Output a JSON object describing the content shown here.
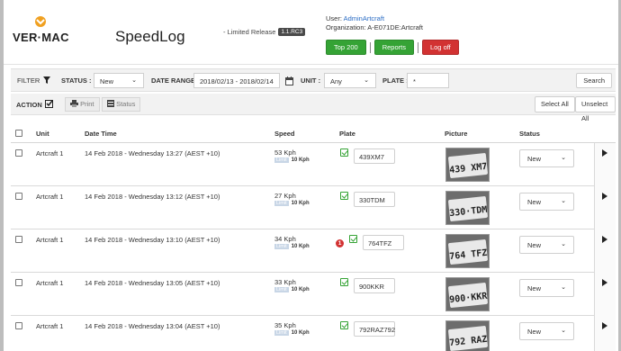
{
  "brand": {
    "logo_text": "VER·MAC",
    "app_title": "SpeedLog",
    "release_text": "- Limited Release",
    "release_badge": "1.1.RC3"
  },
  "user": {
    "user_label": "User:",
    "user_name": "AdminArtcraft",
    "org_line": "Organization: A-E071DE:Artcraft"
  },
  "header_buttons": {
    "top200": "Top 200",
    "reports": "Reports",
    "logoff": "Log off"
  },
  "filter": {
    "label": "FILTER",
    "status_label": "STATUS :",
    "status_value": "New",
    "date_label": "DATE RANGE :",
    "date_value": "2018/02/13 - 2018/02/14",
    "unit_label": "UNIT :",
    "unit_value": "Any",
    "plate_label": "PLATE :",
    "plate_value": "*",
    "search_label": "Search"
  },
  "actions": {
    "label": "ACTION",
    "print": "Print",
    "status": "Status",
    "select_all": "Select All",
    "unselect_all": "Unselect All"
  },
  "columns": {
    "unit": "Unit",
    "datetime": "Date Time",
    "speed": "Speed",
    "plate": "Plate",
    "picture": "Picture",
    "status": "Status"
  },
  "rows": [
    {
      "unit": "Artcraft 1",
      "datetime": "14 Feb 2018 - Wednesday 13:27 (AEST +10)",
      "speed": "53 Kph",
      "limit_tag": "Limit",
      "limit": "10 Kph",
      "plate": "439XM7",
      "picture_text": "439 XM7",
      "status": "New",
      "warning": ""
    },
    {
      "unit": "Artcraft 1",
      "datetime": "14 Feb 2018 - Wednesday 13:12 (AEST +10)",
      "speed": "27 Kph",
      "limit_tag": "Limit",
      "limit": "10 Kph",
      "plate": "330TDM",
      "picture_text": "330·TDM",
      "status": "New",
      "warning": ""
    },
    {
      "unit": "Artcraft 1",
      "datetime": "14 Feb 2018 - Wednesday 13:10 (AEST +10)",
      "speed": "34 Kph",
      "limit_tag": "Limit",
      "limit": "10 Kph",
      "plate": "764TFZ",
      "picture_text": "764 TFZ",
      "status": "New",
      "warning": "1"
    },
    {
      "unit": "Artcraft 1",
      "datetime": "14 Feb 2018 - Wednesday 13:05 (AEST +10)",
      "speed": "33 Kph",
      "limit_tag": "Limit",
      "limit": "10 Kph",
      "plate": "900KKR",
      "picture_text": "900·KKR",
      "status": "New",
      "warning": ""
    },
    {
      "unit": "Artcraft 1",
      "datetime": "14 Feb 2018 - Wednesday 13:04 (AEST +10)",
      "speed": "35 Kph",
      "limit_tag": "Limit",
      "limit": "10 Kph",
      "plate": "792RAZ792",
      "picture_text": "792 RAZ",
      "status": "New",
      "warning": ""
    }
  ],
  "colors": {
    "accent_green": "#35a335",
    "logoff_red": "#d23232",
    "brand_orange": "#f0a020",
    "link_blue": "#2a6cc4"
  }
}
